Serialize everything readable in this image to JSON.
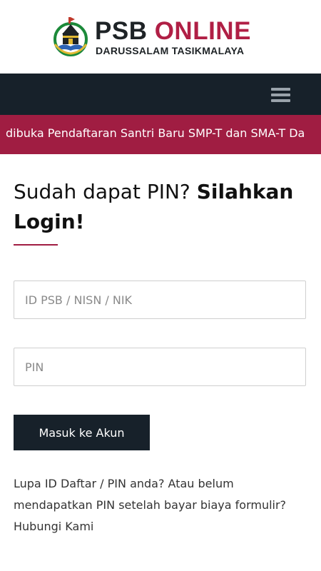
{
  "header": {
    "brand_part1": "PSB",
    "brand_part2": "ONLINE",
    "subtitle": "DARUSSALAM TASIKMALAYA"
  },
  "nav": {
    "menu_icon": "hamburger-menu-icon"
  },
  "announcement": {
    "text": "dibuka Pendaftaran Santri Baru SMP-T dan SMA-T Da"
  },
  "login": {
    "heading_normal": "Sudah dapat PIN?",
    "heading_bold": "Silahkan Login!",
    "id_placeholder": "ID PSB / NISN / NIK",
    "pin_placeholder": "PIN",
    "submit_label": "Masuk ke Akun",
    "help_text": "Lupa ID Daftar / PIN anda? Atau belum mendapatkan PIN setelah bayar biaya formulir?",
    "help_link": "Hubungi Kami"
  },
  "colors": {
    "accent": "#a01d42",
    "navbar": "#17212a",
    "brand_red": "#b01f45"
  }
}
